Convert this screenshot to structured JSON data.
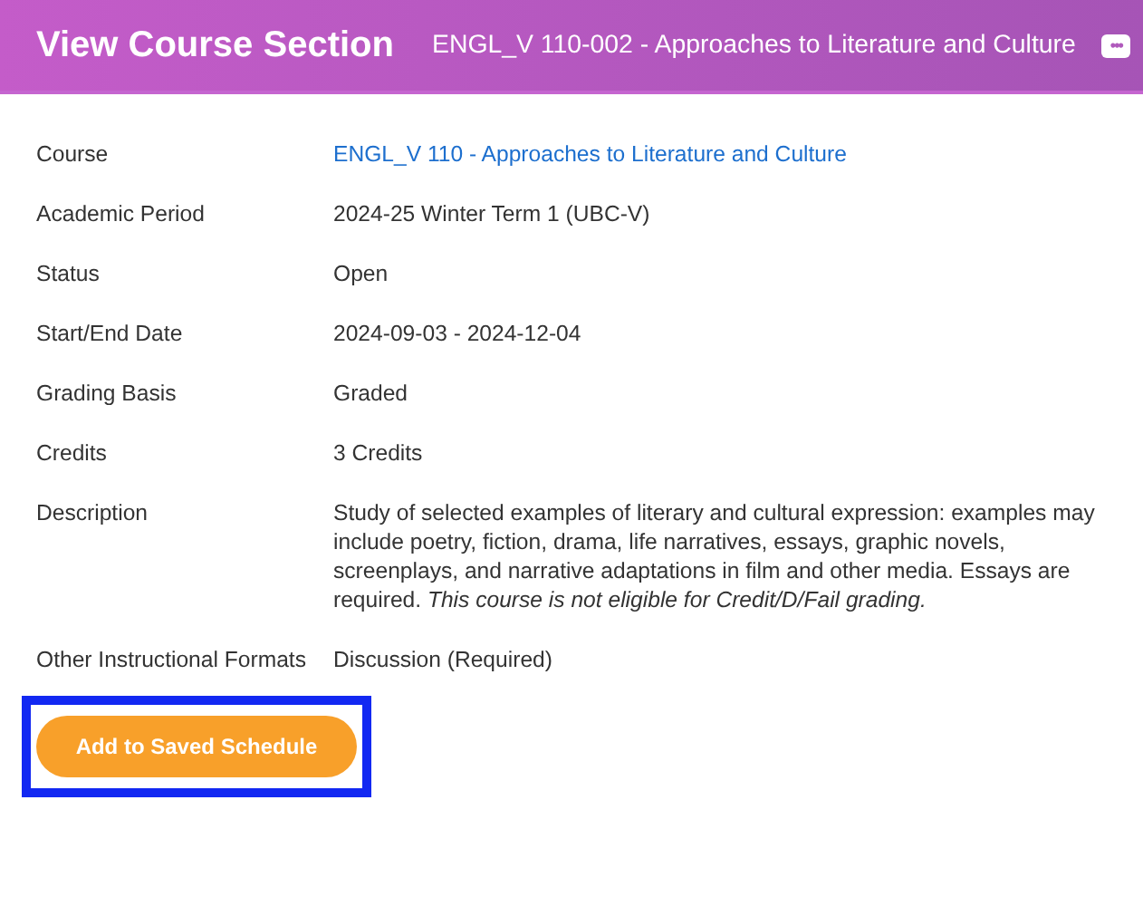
{
  "header": {
    "title": "View Course Section",
    "subtitle": "ENGL_V 110-002 - Approaches to Literature and Culture",
    "menu_button": "•••"
  },
  "fields": [
    {
      "label": "Course",
      "value": "ENGL_V 110 - Approaches to Literature and Culture",
      "kind": "link"
    },
    {
      "label": "Academic Period",
      "value": "2024-25 Winter Term 1 (UBC-V)",
      "kind": "text"
    },
    {
      "label": "Status",
      "value": "Open",
      "kind": "text"
    },
    {
      "label": "Start/End Date",
      "value": "2024-09-03 - 2024-12-04",
      "kind": "text"
    },
    {
      "label": "Grading Basis",
      "value": "Graded",
      "kind": "text"
    },
    {
      "label": "Credits",
      "value": "3 Credits",
      "kind": "text"
    },
    {
      "label": "Description",
      "value": "Study of selected examples of literary and cultural expression: examples may include poetry, fiction, drama, life narratives, essays, graphic novels, screenplays, and narrative adaptations in film and other media. Essays are required. *This course is not eligible for Credit/D/Fail grading.*",
      "kind": "text"
    },
    {
      "label": "Other Instructional Formats",
      "value": "Discussion (Required)",
      "kind": "text"
    }
  ],
  "action_button": {
    "label": "Add to Saved Schedule",
    "highlighted": true
  }
}
